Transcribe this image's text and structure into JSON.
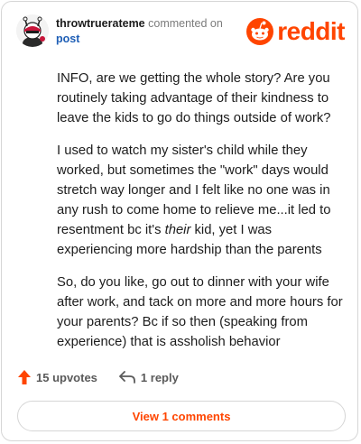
{
  "comment": {
    "username": "throwtruerateme",
    "action": "commented on",
    "target": "post",
    "paragraphs": {
      "p1": "INFO, are we getting the whole story? Are you routinely taking advantage of their kindness to leave the kids to go do things outside of work?",
      "p2_before": "I used to watch my sister's child while they worked, but sometimes the \"work\" days would stretch way longer and I felt like no one was in any rush to come home to relieve me...it led to resentment bc it's ",
      "p2_em": "their",
      "p2_after": " kid, yet I was experiencing more hardship than the parents",
      "p3": "So, do you like, go out to dinner with your wife after work, and tack on more and more hours for your parents? Bc if so then (speaking from experience) that is assholish behavior"
    }
  },
  "brand": {
    "wordmark": "reddit",
    "icon": "reddit-snoo-icon",
    "color": "#ff4500"
  },
  "footer": {
    "upvotes": "15 upvotes",
    "replies": "1 reply",
    "upvote_icon": "upvote-arrow-icon",
    "reply_icon": "reply-arrow-icon",
    "upvote_color": "#ff4500"
  },
  "view_comments": {
    "label": "View 1 comments"
  }
}
